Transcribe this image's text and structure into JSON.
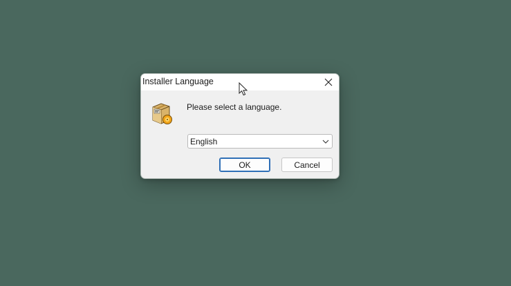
{
  "desktop": {
    "background_color": "#4a685e"
  },
  "dialog": {
    "title": "Installer Language",
    "close_icon": "close-icon",
    "app_icon": "installer-package-icon",
    "prompt": "Please select a language.",
    "language_select": {
      "selected": "English",
      "chevron_icon": "chevron-down-icon"
    },
    "buttons": {
      "ok_label": "OK",
      "cancel_label": "Cancel"
    },
    "accent_color": "#2f6fb6"
  },
  "cursor": {
    "icon": "mouse-pointer-icon"
  }
}
